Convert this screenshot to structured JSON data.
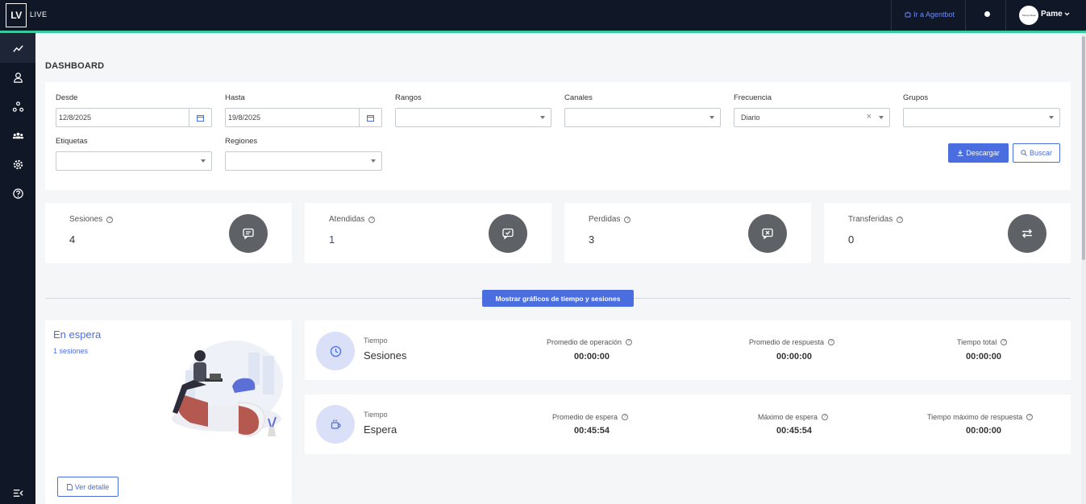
{
  "topbar": {
    "logo": "LV",
    "app_name": "LIVE",
    "agentbot_link": "Ir a Agentbot",
    "user_name": "Pame",
    "avatar_text": "Tiempo Real"
  },
  "sidebar": {
    "items": [
      {
        "icon": "trend-chart-icon",
        "active": true
      },
      {
        "icon": "user-icon"
      },
      {
        "icon": "network-icon"
      },
      {
        "icon": "group-icon"
      },
      {
        "icon": "gear-icon"
      },
      {
        "icon": "help-icon"
      }
    ],
    "collapse_icon": "collapse-menu-icon"
  },
  "page": {
    "title": "DASHBOARD"
  },
  "filters": {
    "desde_label": "Desde",
    "desde_value": "12/8/2025",
    "hasta_label": "Hasta",
    "hasta_value": "19/8/2025",
    "rangos_label": "Rangos",
    "canales_label": "Canales",
    "frecuencia_label": "Frecuencia",
    "frecuencia_value": "Diario",
    "grupos_label": "Grupos",
    "etiquetas_label": "Etiquetas",
    "regiones_label": "Regiones",
    "download_label": "Descargar",
    "search_label": "Buscar"
  },
  "stats": [
    {
      "label": "Sesiones",
      "value": "4",
      "icon": "chat-icon"
    },
    {
      "label": "Atendidas",
      "value": "1",
      "icon": "chat-check-icon"
    },
    {
      "label": "Perdidas",
      "value": "3",
      "icon": "chat-x-icon"
    },
    {
      "label": "Transferidas",
      "value": "0",
      "icon": "transfer-icon"
    }
  ],
  "toggle_charts_label": "Mostrar gráficos de tiempo y sesiones",
  "waiting": {
    "title": "En espera",
    "subtitle": "1 sesiones",
    "detail_button": "Ver detalle"
  },
  "time_cards": [
    {
      "small": "Tiempo",
      "big": "Sesiones",
      "icon": "clock-icon",
      "metrics": [
        {
          "label": "Promedio de operación",
          "value": "00:00:00"
        },
        {
          "label": "Promedio de respuesta",
          "value": "00:00:00"
        },
        {
          "label": "Tiempo total",
          "value": "00:00:00"
        }
      ]
    },
    {
      "small": "Tiempo",
      "big": "Espera",
      "icon": "coffee-icon",
      "metrics": [
        {
          "label": "Promedio de espera",
          "value": "00:45:54"
        },
        {
          "label": "Máximo de espera",
          "value": "00:45:54"
        },
        {
          "label": "Tiempo máximo de respuesta",
          "value": "00:00:00"
        }
      ]
    }
  ],
  "colors": {
    "topbar": "#101727",
    "accent_line": "#35c99b",
    "primary": "#4a6ee0",
    "stat_icon_bg": "#5e6267",
    "time_icon_bg": "#d9e0f7"
  }
}
